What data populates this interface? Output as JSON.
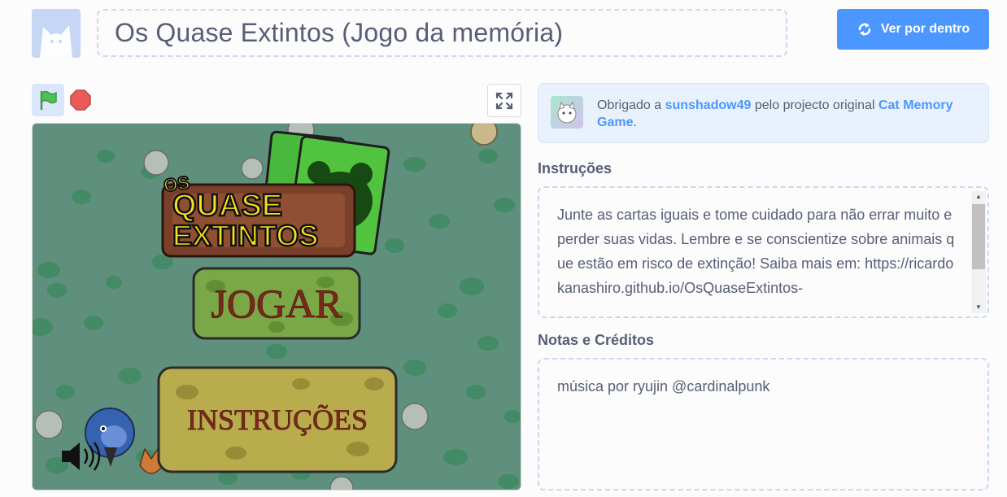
{
  "header": {
    "title": "Os Quase Extintos (Jogo da memória)",
    "see_inside_label": "Ver por dentro"
  },
  "stage": {
    "logo_line1": "OS",
    "logo_line2": "QUASE",
    "logo_line3": "EXTINTOS",
    "play_button_label": "JOGAR",
    "instructions_button_label": "INSTRUÇÕES"
  },
  "remix": {
    "prefix": "Obrigado a ",
    "author": "sunshadow49",
    "middle": " pelo projecto original ",
    "project": "Cat Memory Game",
    "suffix": "."
  },
  "instructions": {
    "label": "Instruções",
    "text": "Junte as cartas iguais e tome cuidado para não errar muito e perder suas vidas. Lembre e se conscientize sobre animais que estão em risco de extinção! Saiba mais em: https://ricardokanashiro.github.io/OsQuaseExtintos-"
  },
  "notes": {
    "label": "Notas e Créditos",
    "text": "música por ryujin @cardinalpunk"
  },
  "colors": {
    "accent": "#4c97ff",
    "stage_bg": "#5f8f7d",
    "flag": "#4cbf56",
    "stop": "#ec5959"
  },
  "icons": [
    "cat-avatar-icon",
    "remix-icon",
    "green-flag-icon",
    "stop-icon",
    "fullscreen-icon",
    "speaker-icon"
  ]
}
